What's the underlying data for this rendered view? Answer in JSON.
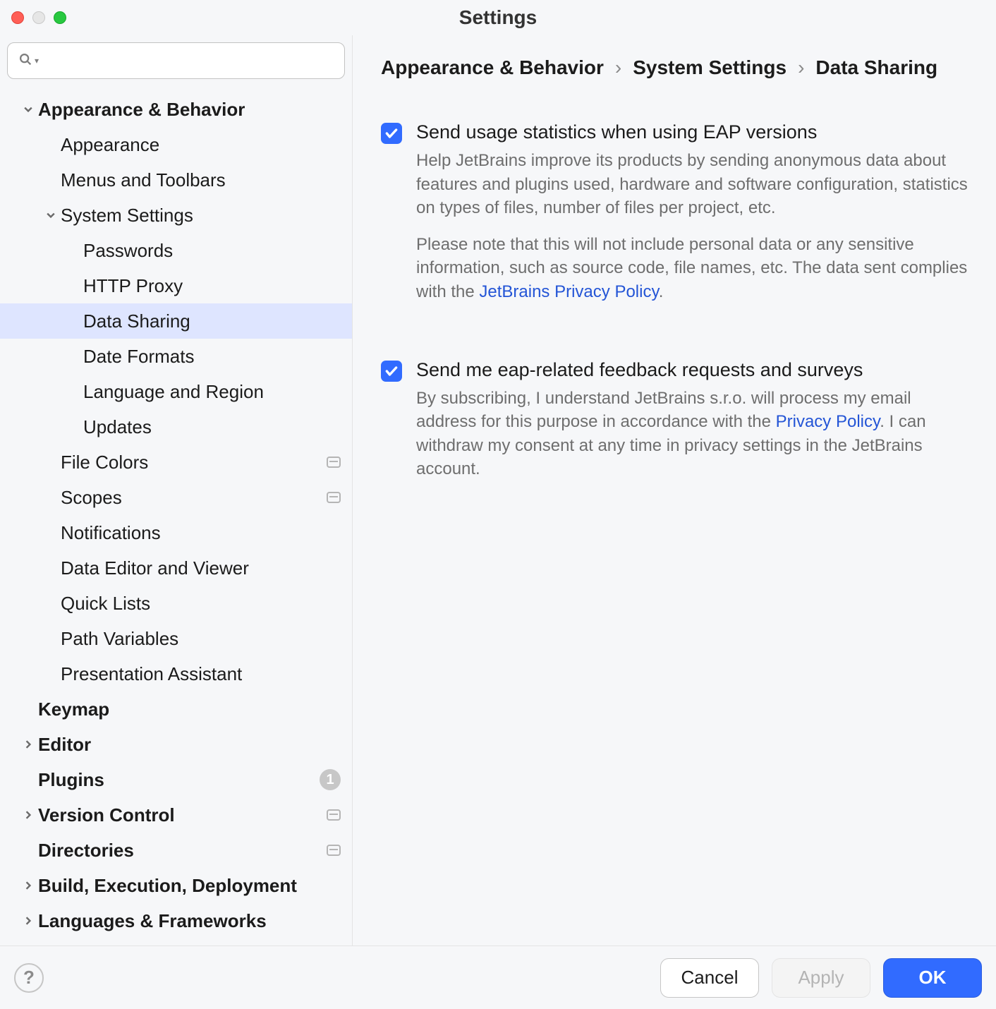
{
  "window": {
    "title": "Settings"
  },
  "search": {
    "placeholder": ""
  },
  "tree": [
    {
      "label": "Appearance & Behavior",
      "bold": true,
      "expanded": true,
      "depth": 0
    },
    {
      "label": "Appearance",
      "depth": 1
    },
    {
      "label": "Menus and Toolbars",
      "depth": 1
    },
    {
      "label": "System Settings",
      "expanded": true,
      "depth": 1
    },
    {
      "label": "Passwords",
      "depth": 2
    },
    {
      "label": "HTTP Proxy",
      "depth": 2
    },
    {
      "label": "Data Sharing",
      "depth": 2,
      "selected": true
    },
    {
      "label": "Date Formats",
      "depth": 2
    },
    {
      "label": "Language and Region",
      "depth": 2
    },
    {
      "label": "Updates",
      "depth": 2
    },
    {
      "label": "File Colors",
      "depth": 1,
      "square": true
    },
    {
      "label": "Scopes",
      "depth": 1,
      "square": true
    },
    {
      "label": "Notifications",
      "depth": 1
    },
    {
      "label": "Data Editor and Viewer",
      "depth": 1
    },
    {
      "label": "Quick Lists",
      "depth": 1
    },
    {
      "label": "Path Variables",
      "depth": 1
    },
    {
      "label": "Presentation Assistant",
      "depth": 1
    },
    {
      "label": "Keymap",
      "bold": true,
      "depth": 0
    },
    {
      "label": "Editor",
      "bold": true,
      "depth": 0,
      "expandable": true
    },
    {
      "label": "Plugins",
      "bold": true,
      "depth": 0,
      "badge": "1"
    },
    {
      "label": "Version Control",
      "bold": true,
      "depth": 0,
      "expandable": true,
      "square": true
    },
    {
      "label": "Directories",
      "bold": true,
      "depth": 0,
      "square": true
    },
    {
      "label": "Build, Execution, Deployment",
      "bold": true,
      "depth": 0,
      "expandable": true
    },
    {
      "label": "Languages & Frameworks",
      "bold": true,
      "depth": 0,
      "expandable": true
    }
  ],
  "breadcrumb": [
    "Appearance & Behavior",
    "System Settings",
    "Data Sharing"
  ],
  "settings": {
    "usage": {
      "title": "Send usage statistics when using EAP versions",
      "desc1": "Help JetBrains improve its products by sending anonymous data about features and plugins used, hardware and software configuration, statistics on types of files, number of files per project, etc.",
      "desc2a": "Please note that this will not include personal data or any sensitive information, such as source code, file names, etc. The data sent complies with the ",
      "desc2link": "JetBrains Privacy Policy",
      "desc2b": ".",
      "checked": true
    },
    "feedback": {
      "title": "Send me eap-related feedback requests and surveys",
      "desc1a": "By subscribing, I understand JetBrains s.r.o. will process my email address for this purpose in accordance with the ",
      "desc1link": "Privacy Policy",
      "desc1b": ". I can withdraw my consent at any time in privacy settings in the JetBrains account.",
      "checked": true
    }
  },
  "footer": {
    "cancel": "Cancel",
    "apply": "Apply",
    "ok": "OK"
  }
}
